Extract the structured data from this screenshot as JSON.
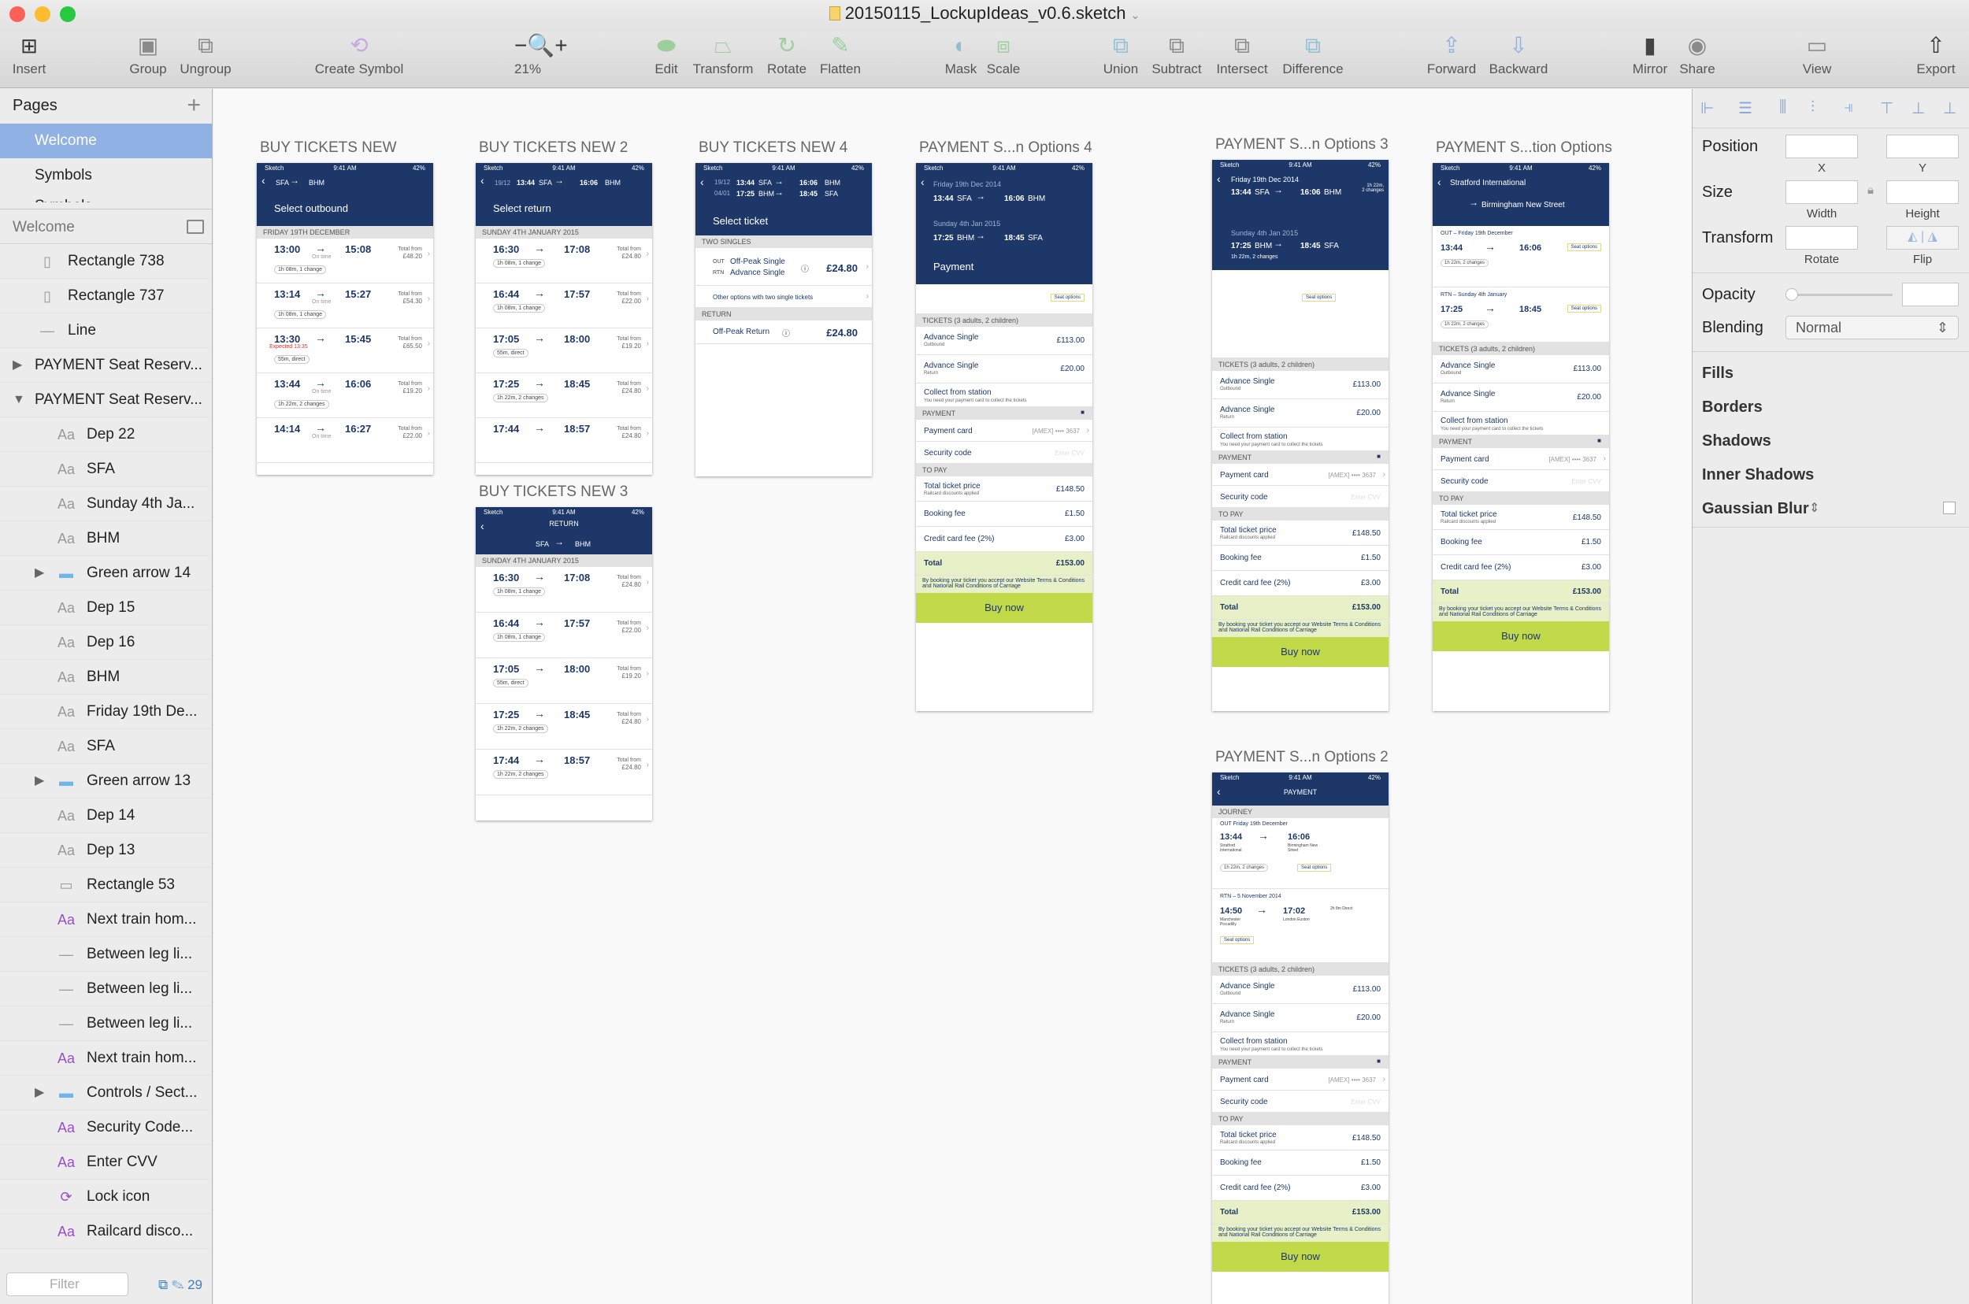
{
  "window": {
    "title": "20150115_LockupIdeas_v0.6.sketch",
    "traffic": {
      "close": "#fe5f57",
      "min": "#febc2e",
      "max": "#28c840"
    }
  },
  "toolbar": {
    "insert": "Insert",
    "group": "Group",
    "ungroup": "Ungroup",
    "create_symbol": "Create Symbol",
    "zoom": "21%",
    "edit": "Edit",
    "transform": "Transform",
    "rotate": "Rotate",
    "flatten": "Flatten",
    "mask": "Mask",
    "scale": "Scale",
    "union": "Union",
    "subtract": "Subtract",
    "intersect": "Intersect",
    "difference": "Difference",
    "forward": "Forward",
    "backward": "Backward",
    "mirror": "Mirror",
    "share": "Share",
    "view": "View",
    "export": "Export"
  },
  "pages": {
    "header": "Pages",
    "items": [
      "Welcome",
      "Symbols",
      "Symbols"
    ]
  },
  "layers": {
    "header": "Welcome",
    "items": [
      {
        "icon": "rect",
        "label": "Rectangle 738"
      },
      {
        "icon": "rect",
        "label": "Rectangle 737"
      },
      {
        "icon": "line",
        "label": "Line"
      },
      {
        "icon": "artboard",
        "label": "PAYMENT Seat Reserv..."
      },
      {
        "icon": "artboard",
        "label": "PAYMENT Seat Reserv..."
      },
      {
        "icon": "text",
        "label": "Dep 22"
      },
      {
        "icon": "text",
        "label": "SFA"
      },
      {
        "icon": "text",
        "label": "Sunday 4th Ja..."
      },
      {
        "icon": "text",
        "label": "BHM"
      },
      {
        "icon": "folder",
        "label": "Green arrow 14"
      },
      {
        "icon": "text",
        "label": "Dep 15"
      },
      {
        "icon": "text",
        "label": "Dep 16"
      },
      {
        "icon": "text",
        "label": "BHM"
      },
      {
        "icon": "text",
        "label": "Friday 19th De..."
      },
      {
        "icon": "text",
        "label": "SFA"
      },
      {
        "icon": "folder",
        "label": "Green arrow 13"
      },
      {
        "icon": "text",
        "label": "Dep 14"
      },
      {
        "icon": "text",
        "label": "Dep 13"
      },
      {
        "icon": "rect2",
        "label": "Rectangle 53"
      },
      {
        "icon": "textp",
        "label": "Next train hom..."
      },
      {
        "icon": "line",
        "label": "Between leg li..."
      },
      {
        "icon": "line",
        "label": "Between leg li..."
      },
      {
        "icon": "line",
        "label": "Between leg li..."
      },
      {
        "icon": "textp",
        "label": "Next train hom..."
      },
      {
        "icon": "folder",
        "label": "Controls / Sect..."
      },
      {
        "icon": "textp",
        "label": "Security Code..."
      },
      {
        "icon": "textp",
        "label": "Enter CVV"
      },
      {
        "icon": "sym",
        "label": "Lock icon"
      },
      {
        "icon": "textp",
        "label": "Railcard disco..."
      }
    ],
    "filter_placeholder": "Filter",
    "count": "29"
  },
  "inspector": {
    "position": "Position",
    "x": "X",
    "y": "Y",
    "size": "Size",
    "width": "Width",
    "height": "Height",
    "transform": "Transform",
    "rotate": "Rotate",
    "flip": "Flip",
    "opacity": "Opacity",
    "blending": "Blending",
    "blend_mode": "Normal",
    "sections": [
      "Fills",
      "Borders",
      "Shadows",
      "Inner Shadows",
      "Gaussian Blur"
    ]
  },
  "artboards": [
    {
      "name": "BUY TICKETS NEW",
      "route": [
        "SFA",
        "BHM"
      ],
      "title": "Select outbound",
      "date": "FRIDAY 19TH DECEMBER",
      "rows": [
        {
          "dep": "13:00",
          "arr": "15:08",
          "status": "On time",
          "dur": "1h 08m, 1 change",
          "price": "£48.20"
        },
        {
          "dep": "13:14",
          "arr": "15:27",
          "status": "On time",
          "dur": "1h 08m, 1 change",
          "price": "£54.30"
        },
        {
          "dep": "13:30",
          "arr": "15:45",
          "status": "Expected 13:35",
          "dur": "55m, direct",
          "price": "£65.50"
        },
        {
          "dep": "13:44",
          "arr": "16:06",
          "status": "On time",
          "dur": "1h 22m, 2 changes",
          "price": "£19.20"
        },
        {
          "dep": "14:14",
          "arr": "16:27",
          "status": "On time",
          "dur": "",
          "price": "£22.00"
        }
      ]
    },
    {
      "name": "BUY TICKETS NEW 2",
      "outbound": {
        "date": "19/12",
        "dep": "13:44",
        "from": "SFA",
        "arr": "16:06",
        "to": "BHM"
      },
      "title": "Select return",
      "date": "SUNDAY 4TH JANUARY 2015",
      "rows": [
        {
          "dep": "16:30",
          "arr": "17:08",
          "dur": "1h 08m, 1 change",
          "price": "£24.80"
        },
        {
          "dep": "16:44",
          "arr": "17:57",
          "dur": "1h 08m, 1 change",
          "price": "£22.00"
        },
        {
          "dep": "17:05",
          "arr": "18:00",
          "dur": "55m, direct",
          "price": "£19.20"
        },
        {
          "dep": "17:25",
          "arr": "18:45",
          "dur": "1h 22m, 2 changes",
          "price": "£24.80"
        },
        {
          "dep": "17:44",
          "arr": "18:57",
          "dur": "",
          "price": "£24.80"
        }
      ]
    },
    {
      "name": "BUY TICKETS NEW 3",
      "subtitle": "RETURN",
      "route": [
        "SFA",
        "BHM"
      ],
      "date": "SUNDAY 4TH JANUARY 2015",
      "rows": [
        {
          "dep": "16:30",
          "arr": "17:08",
          "dur": "1h 08m, 1 change",
          "price": "£24.80"
        },
        {
          "dep": "16:44",
          "arr": "17:57",
          "dur": "1h 08m, 1 change",
          "price": "£22.00"
        },
        {
          "dep": "17:05",
          "arr": "18:00",
          "dur": "55m, direct",
          "price": "£19.20"
        },
        {
          "dep": "17:25",
          "arr": "18:45",
          "dur": "1h 22m, 2 changes",
          "price": "£24.80"
        },
        {
          "dep": "17:44",
          "arr": "18:57",
          "dur": "1h 22m, 2 changes",
          "price": "£24.80"
        }
      ]
    },
    {
      "name": "BUY TICKETS NEW 4",
      "legs": [
        {
          "date": "19/12",
          "dep": "13:44",
          "from": "SFA",
          "arr": "16:06",
          "to": "BHM"
        },
        {
          "date": "04/01",
          "dep": "17:25",
          "from": "BHM",
          "arr": "18:45",
          "to": "SFA"
        }
      ],
      "title": "Select ticket",
      "two_singles": "TWO SINGLES",
      "out_label": "OUT",
      "rtn_label": "RTN",
      "out_ticket": "Off-Peak Single",
      "rtn_ticket": "Advance Single",
      "singles_price": "£24.80",
      "other": "Other options with two single tickets",
      "return_hdr": "RETURN",
      "return_ticket": "Off-Peak Return",
      "return_price": "£24.80"
    },
    {
      "name": "PAYMENT S...n Options 4",
      "title": "Payment",
      "out_date": "Friday 19th Dec 2014",
      "rtn_date": "Sunday 4th Jan 2015"
    },
    {
      "name": "PAYMENT S...n Options 3",
      "out_date": "Friday 19th Dec 2014",
      "rtn_date": "Sunday 4th Jan 2015",
      "summary": "1h 22m,\n2 changes"
    },
    {
      "name": "PAYMENT S...tion Options",
      "origin": "Stratford International",
      "destination": "Birmingham New Street",
      "out": "OUT – Friday 19th December",
      "rtn": "RTN – Sunday 4th January"
    },
    {
      "name": "PAYMENT S...n Options 2",
      "title": "PAYMENT",
      "journey": "JOURNEY",
      "out": "OUT Friday 19th December",
      "out_from": "Stratford International",
      "out_to": "Birmingham New Street",
      "rtn": "RTN – 5 November 2014",
      "rtn_dep": "14:50",
      "rtn_arr": "17:02",
      "rtn_from": "Manchester Piccadilly",
      "rtn_to": "London Euston",
      "rtn_dur": "2h 8m Direct"
    }
  ],
  "common": {
    "carrier": "Sketch",
    "clock": "9:41 AM",
    "battery": "42%",
    "seat_options": "Seat options",
    "tickets_hdr": "TICKETS (3 adults, 2 children)",
    "t1": "Advance Single",
    "t1_sub": "Outbound",
    "t1_price": "£113.00",
    "t2": "Advance Single",
    "t2_sub": "Return",
    "t2_price": "£20.00",
    "collect": "Collect from station",
    "collect_sub": "You need your payment card to collect the tickets",
    "payment_hdr": "PAYMENT",
    "payment_card": "Payment card",
    "card_value": "[AMEX] •••• 3637",
    "security_code": "Security code",
    "cvv": "Enter CVV",
    "to_pay": "TO PAY",
    "total_ticket": "Total ticket price",
    "railcard": "Railcard discounts applied",
    "total_ticket_price": "£148.50",
    "booking_fee": "Booking fee",
    "booking_fee_price": "£1.50",
    "cc_fee": "Credit card fee (2%)",
    "cc_fee_price": "£3.00",
    "total": "Total",
    "total_price": "£153.00",
    "terms": "By booking your ticket you accept our Website Terms & Conditions and National Rail Conditions of Carriage",
    "buy_now": "Buy now",
    "total_from": "Total from",
    "dep1": "13:44",
    "arr1": "16:06",
    "from1": "SFA",
    "to1": "BHM",
    "dep2": "17:25",
    "arr2": "18:45",
    "from2": "BHM",
    "to2": "SFA",
    "dur1": "1h 22m, 2 changes",
    "accent": "#1d3868",
    "buy_color": "#c2d94a"
  }
}
